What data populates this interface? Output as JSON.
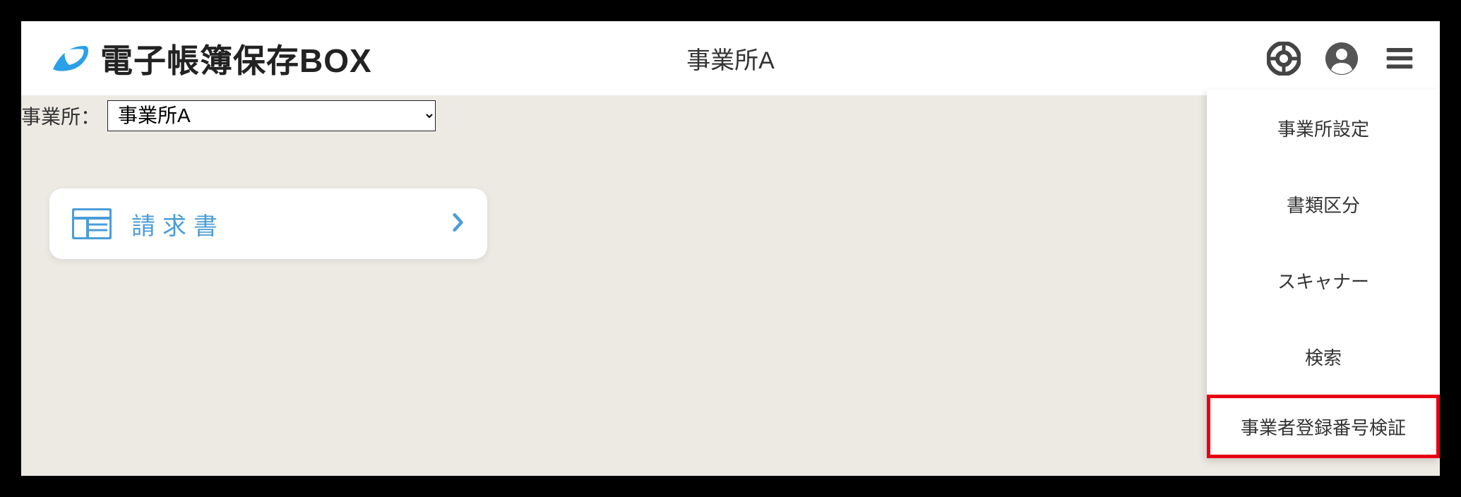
{
  "header": {
    "app_name": "電子帳簿保存BOX",
    "current_office": "事業所A"
  },
  "filter": {
    "label": "事業所：",
    "selected": "事業所A"
  },
  "card": {
    "label": "請求書"
  },
  "menu": {
    "items": [
      "事業所設定",
      "書類区分",
      "スキャナー",
      "検索",
      "事業者登録番号検証"
    ]
  }
}
